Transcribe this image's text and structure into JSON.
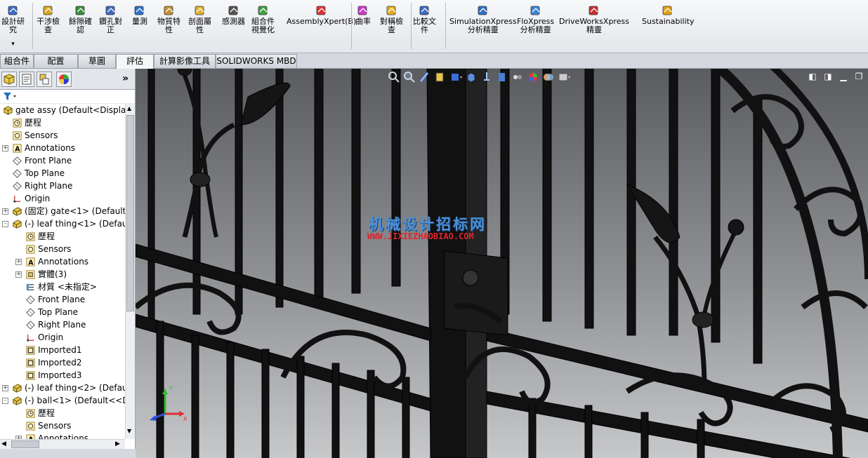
{
  "ribbon": {
    "buttons": [
      {
        "label": "設計研\n究",
        "icon": "design-study-icon"
      },
      {
        "label": "干涉檢\n查",
        "icon": "interference-icon"
      },
      {
        "label": "餘隙確\n認",
        "icon": "clearance-icon"
      },
      {
        "label": "鑽孔對\n正",
        "icon": "hole-align-icon"
      },
      {
        "label": "量測",
        "icon": "measure-icon"
      },
      {
        "label": "物質特\n性",
        "icon": "mass-properties-icon"
      },
      {
        "label": "剖面屬\n性",
        "icon": "section-properties-icon"
      },
      {
        "label": "感測器",
        "icon": "sensor-icon"
      },
      {
        "label": "組合件\n視覺化",
        "icon": "assembly-visualization-icon"
      },
      {
        "label": "AssemblyXpert(B)",
        "icon": "assemblyxpert-icon"
      },
      {
        "label": "曲率",
        "icon": "curvature-icon"
      },
      {
        "label": "對稱檢\n查",
        "icon": "symmetry-icon"
      },
      {
        "label": "比較文\n件",
        "icon": "compare-icon"
      },
      {
        "label": "SimulationXpress\n分析精靈",
        "icon": "simulationxpress-icon"
      },
      {
        "label": "FloXpress\n分析精靈",
        "icon": "floxpress-icon"
      },
      {
        "label": "DriveWorksXpress\n精靈",
        "icon": "driveworksxpress-icon"
      },
      {
        "label": "Sustainability",
        "icon": "sustainability-icon"
      }
    ]
  },
  "command_tabs": [
    "組合件",
    "配置",
    "草圖",
    "評估",
    "計算影像工具",
    "SOLIDWORKS MBD"
  ],
  "active_tab": "評估",
  "tree": [
    {
      "label": "gate assy  (Default<Display",
      "icon": "assembly-icon",
      "level": 0,
      "exp": ""
    },
    {
      "label": "歷程",
      "icon": "history-icon",
      "level": 1,
      "exp": ""
    },
    {
      "label": "Sensors",
      "icon": "sensors-icon",
      "level": 1,
      "exp": ""
    },
    {
      "label": "Annotations",
      "icon": "annotations-icon",
      "level": 1,
      "exp": "+"
    },
    {
      "label": "Front Plane",
      "icon": "plane-icon",
      "level": 1,
      "exp": ""
    },
    {
      "label": "Top Plane",
      "icon": "plane-icon",
      "level": 1,
      "exp": ""
    },
    {
      "label": "Right Plane",
      "icon": "plane-icon",
      "level": 1,
      "exp": ""
    },
    {
      "label": "Origin",
      "icon": "origin-icon",
      "level": 1,
      "exp": ""
    },
    {
      "label": "(固定) gate<1> (Default<",
      "icon": "part-icon",
      "level": 1,
      "exp": "+"
    },
    {
      "label": "(-) leaf thing<1> (Defaul",
      "icon": "part-icon",
      "level": 1,
      "exp": "-"
    },
    {
      "label": "歷程",
      "icon": "history-icon",
      "level": 2,
      "exp": ""
    },
    {
      "label": "Sensors",
      "icon": "sensors-icon",
      "level": 2,
      "exp": ""
    },
    {
      "label": "Annotations",
      "icon": "annotations-icon",
      "level": 2,
      "exp": "+"
    },
    {
      "label": "實體(3)",
      "icon": "solid-bodies-icon",
      "level": 2,
      "exp": "+"
    },
    {
      "label": "材質 <未指定>",
      "icon": "material-icon",
      "level": 2,
      "exp": ""
    },
    {
      "label": "Front Plane",
      "icon": "plane-icon",
      "level": 2,
      "exp": ""
    },
    {
      "label": "Top Plane",
      "icon": "plane-icon",
      "level": 2,
      "exp": ""
    },
    {
      "label": "Right Plane",
      "icon": "plane-icon",
      "level": 2,
      "exp": ""
    },
    {
      "label": "Origin",
      "icon": "origin-icon",
      "level": 2,
      "exp": ""
    },
    {
      "label": "Imported1",
      "icon": "imported-feature-icon",
      "level": 2,
      "exp": ""
    },
    {
      "label": "Imported2",
      "icon": "imported-feature-icon",
      "level": 2,
      "exp": ""
    },
    {
      "label": "Imported3",
      "icon": "imported-feature-icon",
      "level": 2,
      "exp": ""
    },
    {
      "label": "(-) leaf thing<2> (Defaul",
      "icon": "part-icon",
      "level": 1,
      "exp": "+"
    },
    {
      "label": "(-) ball<1> (Default<<D",
      "icon": "part-icon",
      "level": 1,
      "exp": "-"
    },
    {
      "label": "歷程",
      "icon": "history-icon",
      "level": 2,
      "exp": ""
    },
    {
      "label": "Sensors",
      "icon": "sensors-icon",
      "level": 2,
      "exp": ""
    },
    {
      "label": "Annotations",
      "icon": "annotations-icon",
      "level": 2,
      "exp": "+"
    }
  ],
  "watermark": {
    "line1": "机械设计招标网",
    "line2": "WWW.JIXIEZHAOBIAO.COM"
  },
  "colors": {
    "accent": "#1f6fc2",
    "watermark_blue": "#4a90d9",
    "watermark_red": "#e0242b"
  }
}
